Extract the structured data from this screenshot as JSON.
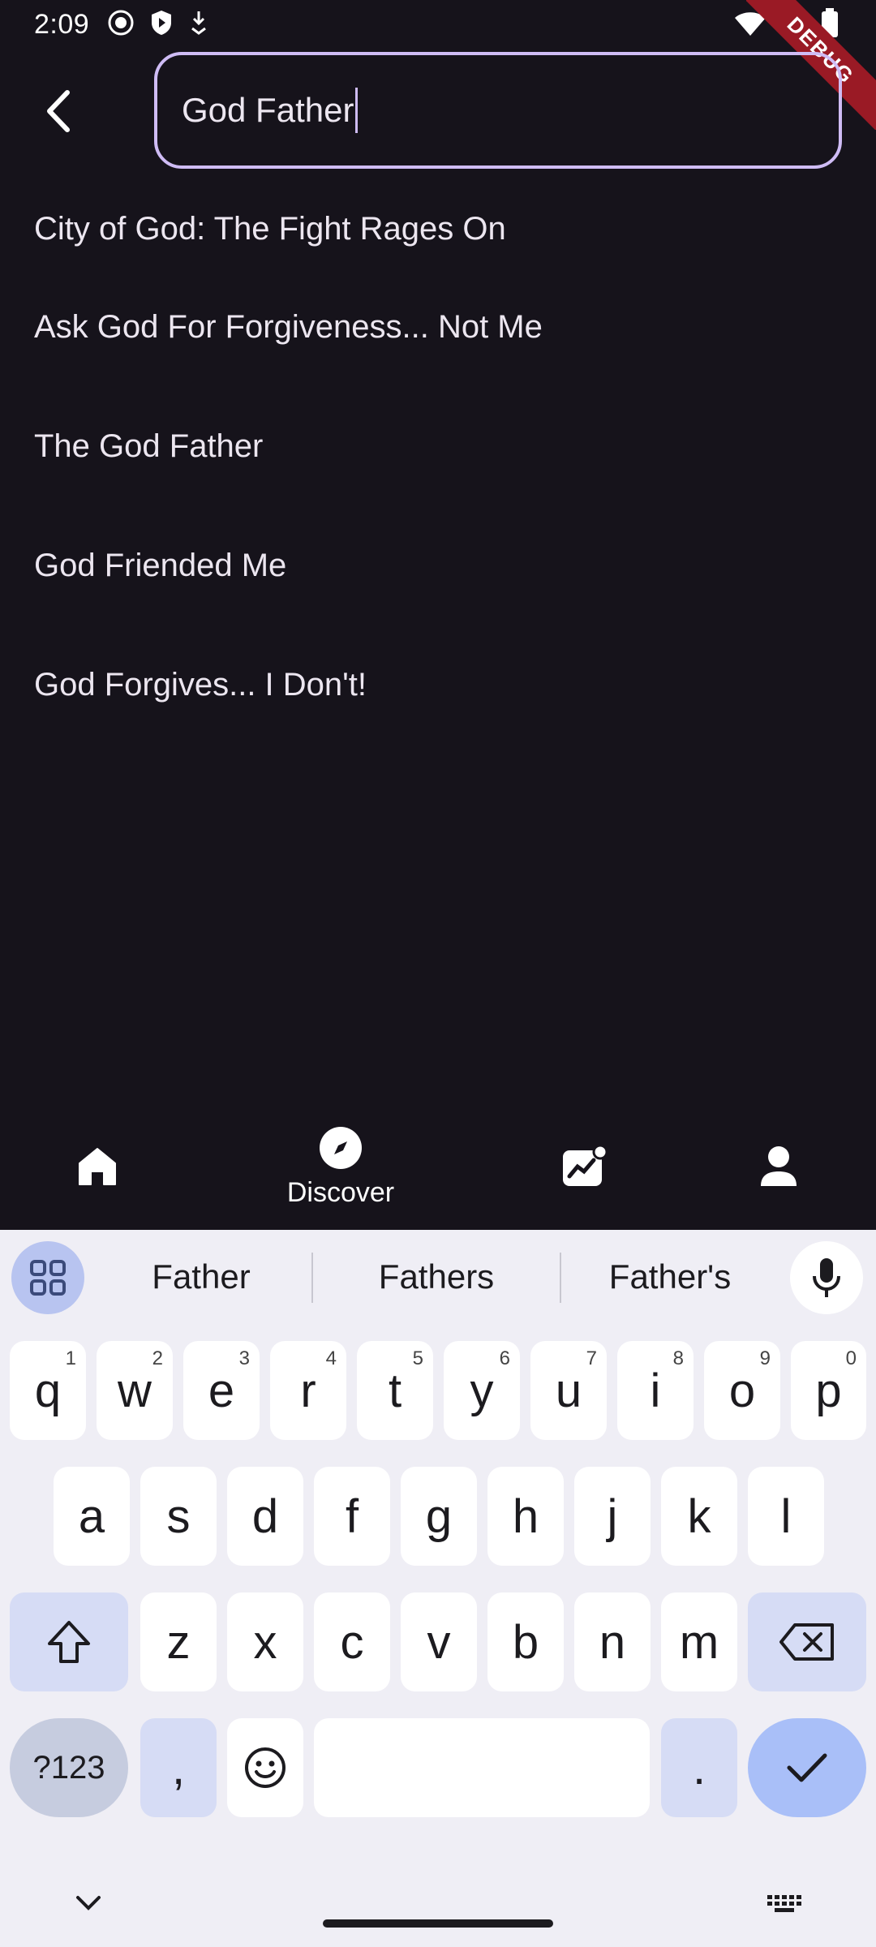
{
  "status_bar": {
    "time": "2:09",
    "debug_label": "DEBUG"
  },
  "search": {
    "value": "God Father"
  },
  "results": [
    "City of God: The Fight Rages On",
    "Ask God For Forgiveness... Not Me",
    "The God Father",
    "God Friended Me",
    "God Forgives... I Don't!"
  ],
  "bottom_nav": {
    "home_icon": "home-icon",
    "discover_label": "Discover",
    "stats_icon": "stats-icon",
    "profile_icon": "person-icon"
  },
  "keyboard": {
    "suggestions": [
      "Father",
      "Fathers",
      "Father's"
    ],
    "row1": [
      "q",
      "w",
      "e",
      "r",
      "t",
      "y",
      "u",
      "i",
      "o",
      "p"
    ],
    "row1_hints": [
      "1",
      "2",
      "3",
      "4",
      "5",
      "6",
      "7",
      "8",
      "9",
      "0"
    ],
    "row2": [
      "a",
      "s",
      "d",
      "f",
      "g",
      "h",
      "j",
      "k",
      "l"
    ],
    "row3": [
      "z",
      "x",
      "c",
      "v",
      "b",
      "n",
      "m"
    ],
    "symbols_label": "?123",
    "comma_label": ",",
    "period_label": "."
  },
  "colors": {
    "background": "#16131b",
    "accent": "#cfbcf5",
    "keyboard_bg": "#efeef5",
    "enter_key": "#a9bff8"
  }
}
